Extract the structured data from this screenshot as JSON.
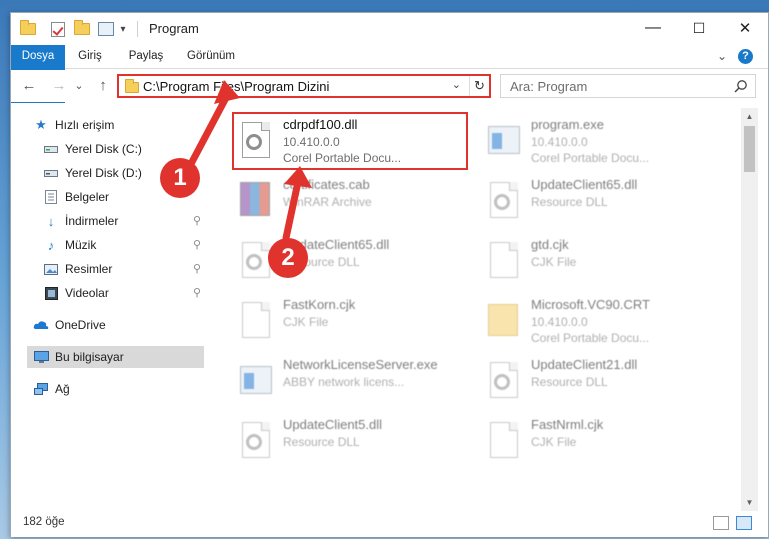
{
  "window": {
    "title": "Program",
    "controls": {
      "minimize": "—",
      "maximize": "☐",
      "close": "✕"
    }
  },
  "ribbon": {
    "tabs": [
      "Dosya",
      "Giriş",
      "Paylaş",
      "Görünüm"
    ],
    "help": "?",
    "expand": "⌄"
  },
  "nav": {
    "back": "←",
    "forward": "→",
    "recent": "⌄",
    "up": "↑",
    "address": "C:\\Program Files\\Program Dizini",
    "address_dropdown": "⌄",
    "refresh": "↻",
    "search_placeholder": "Ara: Program"
  },
  "sidebar": {
    "items": [
      {
        "label": "Hızlı erişim",
        "icon": "star-icon",
        "pinned": false
      },
      {
        "label": "Yerel Disk (C:)",
        "icon": "drive-icon",
        "pinned": false
      },
      {
        "label": "Yerel Disk (D:)",
        "icon": "drive-icon",
        "pinned": false
      },
      {
        "label": "Belgeler",
        "icon": "documents-icon",
        "pinned": false
      },
      {
        "label": "İndirmeler",
        "icon": "download-icon",
        "pinned": true
      },
      {
        "label": "Müzik",
        "icon": "music-icon",
        "pinned": true
      },
      {
        "label": "Resimler",
        "icon": "pictures-icon",
        "pinned": true
      },
      {
        "label": "Videolar",
        "icon": "videos-icon",
        "pinned": true
      },
      {
        "label": "OneDrive",
        "icon": "cloud-icon",
        "pinned": false
      },
      {
        "label": "Bu bilgisayar",
        "icon": "computer-icon",
        "pinned": false
      },
      {
        "label": "Ağ",
        "icon": "network-icon",
        "pinned": false
      }
    ],
    "pin_glyph": "📌"
  },
  "files": [
    {
      "name": "cdrpdf100.dll",
      "line2": "10.410.0.0",
      "line3": "Corel Portable Docu...",
      "icon": "dll-gear-icon",
      "highlighted": true
    },
    {
      "name": "program.exe",
      "line2": "10.410.0.0",
      "line3": "Corel Portable Docu...",
      "icon": "exe-icon",
      "highlighted": false
    },
    {
      "name": "certificates.cab",
      "line2": "WinRAR Archive",
      "line3": "",
      "icon": "archive-icon",
      "highlighted": false
    },
    {
      "name": "UpdateClient65.dll",
      "line2": "Resource DLL",
      "line3": "",
      "icon": "dll-gear-icon",
      "highlighted": false
    },
    {
      "name": "UpdateClient65.dll",
      "line2": "Resource DLL",
      "line3": "",
      "icon": "dll-gear-icon",
      "highlighted": false
    },
    {
      "name": "gtd.cjk",
      "line2": "CJK File",
      "line3": "",
      "icon": "blank-file-icon",
      "highlighted": false
    },
    {
      "name": "FastKorn.cjk",
      "line2": "CJK File",
      "line3": "",
      "icon": "blank-file-icon",
      "highlighted": false
    },
    {
      "name": "Microsoft.VC90.CRT",
      "line2": "10.410.0.0",
      "line3": "Corel Portable Docu...",
      "icon": "folder-icon",
      "highlighted": false
    },
    {
      "name": "NetworkLicenseServer.exe",
      "line2": "ABBY network licens...",
      "line3": "",
      "icon": "exe-icon",
      "highlighted": false
    },
    {
      "name": "UpdateClient21.dll",
      "line2": "Resource DLL",
      "line3": "",
      "icon": "dll-gear-icon",
      "highlighted": false
    },
    {
      "name": "UpdateClient5.dll",
      "line2": "Resource DLL",
      "line3": "",
      "icon": "dll-gear-icon",
      "highlighted": false
    },
    {
      "name": "FastNrml.cjk",
      "line2": "CJK File",
      "line3": "",
      "icon": "blank-file-icon",
      "highlighted": false
    }
  ],
  "status": {
    "item_count": "182 öğe"
  },
  "annotations": {
    "step1": "1",
    "step2": "2",
    "color": "#e0332e"
  },
  "colors": {
    "accent": "#1979ca",
    "highlight": "#e0332e",
    "selected_bg": "#d9d9d9"
  }
}
